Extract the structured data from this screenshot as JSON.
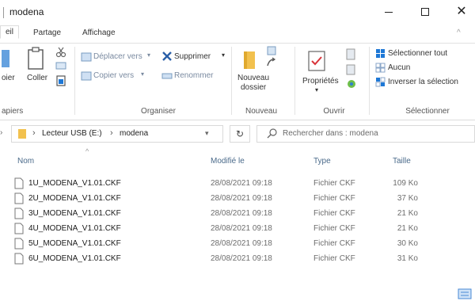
{
  "window": {
    "title": "modena",
    "minimize_icon": "minimize-icon",
    "maximize_icon": "maximize-icon",
    "close_icon": "close-icon",
    "close_glyph": "✕"
  },
  "ribbon_tabs": [
    {
      "label": "eil"
    },
    {
      "label": "Partage"
    },
    {
      "label": "Affichage"
    }
  ],
  "ribbon": {
    "clipboard": {
      "pin_label": "oier",
      "paste_label": "Coller",
      "group_label": "apiers"
    },
    "organize": {
      "move_label": "Déplacer vers",
      "copy_label": "Copier vers",
      "delete_label": "Supprimer",
      "rename_label": "Renommer",
      "group_label": "Organiser"
    },
    "new": {
      "new_folder_label_1": "Nouveau",
      "new_folder_label_2": "dossier",
      "group_label": "Nouveau"
    },
    "open": {
      "properties_label": "Propriétés",
      "group_label": "Ouvrir"
    },
    "select": {
      "select_all_label": "Sélectionner tout",
      "none_label": "Aucun",
      "invert_label": "Inverser la sélection",
      "group_label": "Sélectionner"
    }
  },
  "address": {
    "crumbs": [
      "Lecteur USB (E:)",
      "modena"
    ],
    "search_placeholder": "Rechercher dans : modena"
  },
  "columns": {
    "name": "Nom",
    "modified": "Modifié le",
    "type": "Type",
    "size": "Taille"
  },
  "files": [
    {
      "name": "1U_MODENA_V1.01.CKF",
      "modified": "28/08/2021 09:18",
      "type": "Fichier CKF",
      "size": "109 Ko"
    },
    {
      "name": "2U_MODENA_V1.01.CKF",
      "modified": "28/08/2021 09:18",
      "type": "Fichier CKF",
      "size": "37 Ko"
    },
    {
      "name": "3U_MODENA_V1.01.CKF",
      "modified": "28/08/2021 09:18",
      "type": "Fichier CKF",
      "size": "21 Ko"
    },
    {
      "name": "4U_MODENA_V1.01.CKF",
      "modified": "28/08/2021 09:18",
      "type": "Fichier CKF",
      "size": "21 Ko"
    },
    {
      "name": "5U_MODENA_V1.01.CKF",
      "modified": "28/08/2021 09:18",
      "type": "Fichier CKF",
      "size": "30 Ko"
    },
    {
      "name": "6U_MODENA_V1.01.CKF",
      "modified": "28/08/2021 09:18",
      "type": "Fichier CKF",
      "size": "31 Ko"
    }
  ],
  "colors": {
    "accent": "#1e78d6",
    "folder": "#f2c14e",
    "header_text": "#4a6a8a"
  }
}
